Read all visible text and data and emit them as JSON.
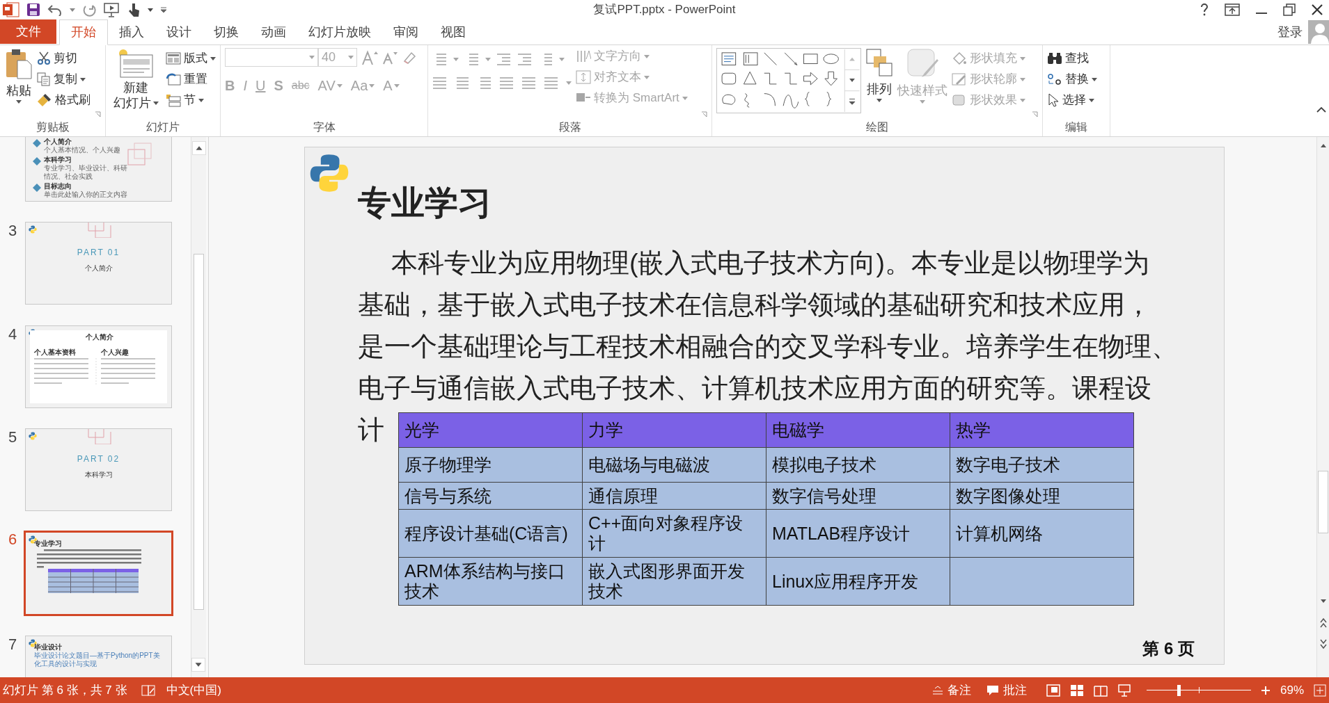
{
  "window": {
    "title": "复试PPT.pptx - PowerPoint"
  },
  "tabs": [
    {
      "label": "文件",
      "kind": "file",
      "selected": false
    },
    {
      "label": "开始",
      "kind": "tab",
      "selected": true
    },
    {
      "label": "插入",
      "kind": "tab",
      "selected": false
    },
    {
      "label": "设计",
      "kind": "tab",
      "selected": false
    },
    {
      "label": "切换",
      "kind": "tab",
      "selected": false
    },
    {
      "label": "动画",
      "kind": "tab",
      "selected": false
    },
    {
      "label": "幻灯片放映",
      "kind": "tab",
      "selected": false
    },
    {
      "label": "审阅",
      "kind": "tab",
      "selected": false
    },
    {
      "label": "视图",
      "kind": "tab",
      "selected": false
    }
  ],
  "account": {
    "label": "登录"
  },
  "ribbon": {
    "clipboard": {
      "label": "剪贴板",
      "paste": "粘贴",
      "items": [
        {
          "label": "剪切",
          "disabled": false
        },
        {
          "label": "复制",
          "disabled": false
        },
        {
          "label": "格式刷",
          "disabled": false
        }
      ]
    },
    "slides": {
      "label": "幻灯片",
      "new_slide": [
        "新建",
        "幻灯片"
      ],
      "items": [
        {
          "label": "版式",
          "disabled": false
        },
        {
          "label": "重置",
          "disabled": false
        },
        {
          "label": "节",
          "disabled": false
        }
      ]
    },
    "font": {
      "label": "字体",
      "font_size": "40",
      "disabled": true,
      "format_buttons": [
        "B",
        "I",
        "U",
        "S",
        "abc",
        "AV",
        "Aa",
        "A"
      ]
    },
    "paragraph": {
      "label": "段落",
      "disabled": true,
      "items": [
        {
          "label": "文字方向",
          "disabled": true
        },
        {
          "label": "对齐文本",
          "disabled": true
        },
        {
          "label": "转换为 SmartArt",
          "disabled": true
        }
      ]
    },
    "drawing": {
      "label": "绘图",
      "arrange": {
        "label": "排列",
        "disabled": false
      },
      "quick_styles": {
        "label": "快速样式",
        "disabled": true
      },
      "items": [
        {
          "label": "形状填充",
          "disabled": true
        },
        {
          "label": "形状轮廓",
          "disabled": true
        },
        {
          "label": "形状效果",
          "disabled": true
        }
      ]
    },
    "editing": {
      "label": "编辑",
      "items": [
        {
          "label": "查找",
          "disabled": false
        },
        {
          "label": "替换",
          "disabled": false
        },
        {
          "label": "选择",
          "disabled": false
        }
      ]
    }
  },
  "thumbnails": [
    {
      "kind": "agenda",
      "selected": false,
      "items": [
        {
          "title": "个人简介",
          "text": "个人基本情况、个人兴趣"
        },
        {
          "title": "本科学习",
          "text": "专业学习、毕业设计、科研情况、社会实践"
        },
        {
          "title": "目标志向",
          "text": "单击此处输入你的正文内容"
        }
      ]
    },
    {
      "number": "3",
      "kind": "section",
      "selected": false,
      "part": "PART 01",
      "title": "个人简介"
    },
    {
      "number": "4",
      "kind": "content",
      "selected": false,
      "title": "个人简介",
      "columns": [
        "个人基本资料",
        "个人兴趣"
      ]
    },
    {
      "number": "5",
      "kind": "section",
      "selected": false,
      "part": "PART 02",
      "title": "本科学习"
    },
    {
      "number": "6",
      "kind": "study",
      "selected": true,
      "title": "专业学习"
    },
    {
      "number": "7",
      "kind": "thesis",
      "selected": false,
      "title": "毕业设计",
      "subtitle": "毕业设计论文题目—基于Python的PPT美化工具的设计与实现"
    }
  ],
  "slide": {
    "title": "专业学习",
    "paragraph_lines": [
      "本科专业为应用物理(嵌入式电子技术方向)。本专业是以物理学为",
      "基础，基于嵌入式电子技术在信息科学领域的基础研究和技术应用，",
      "是一个基础理论与工程技术相融合的交叉学科专业。培养学生在物理、",
      "电子与通信嵌入式电子技术、计算机技术应用方面的研究等。课程设",
      "计"
    ],
    "table": {
      "header": [
        "光学",
        "力学",
        "电磁学",
        "热学"
      ],
      "rows": [
        [
          "原子物理学",
          "电磁场与电磁波",
          "模拟电子技术",
          "数字电子技术"
        ],
        [
          "信号与系统",
          "通信原理",
          "数字信号处理",
          "数字图像处理"
        ],
        [
          "程序设计基础(C语言)",
          "C++面向对象程序设计",
          "MATLAB程序设计",
          "计算机网络"
        ],
        [
          "ARM体系结构与接口技术",
          "嵌入式图形界面开发技术",
          "Linux应用程序开发"
        ]
      ]
    },
    "page_number": "第 6 页"
  },
  "status_bar": {
    "slide_info": "幻灯片 第 6 张，共 7 张",
    "language": "中文(中国)",
    "notes": "备注",
    "comments": "批注",
    "zoom": {
      "level": 0.31
    },
    "zoom_reading": "69%"
  }
}
